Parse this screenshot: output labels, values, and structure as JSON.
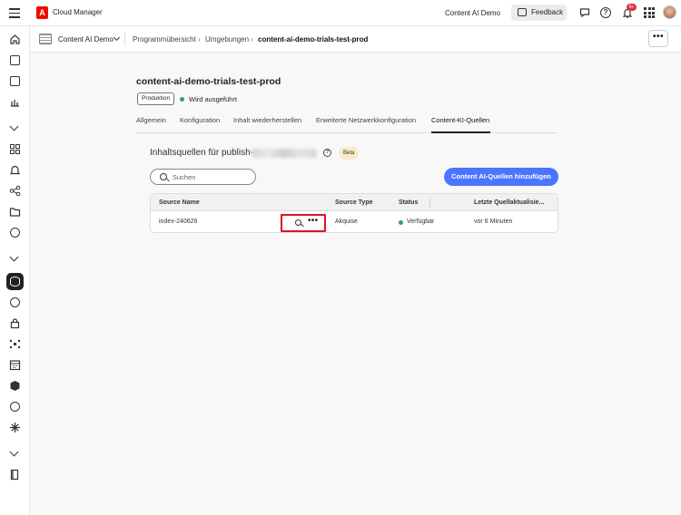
{
  "app": {
    "title": "Cloud Manager",
    "logo_letter": "A",
    "org_name": "Content AI Demo",
    "feedback_label": "Feedback",
    "notification_count": "9+"
  },
  "breadcrumb": {
    "program_name": "Content AI Demo",
    "items": [
      "Programmübersicht",
      "Umgebungen",
      "content-ai-demo-trials-test-prod"
    ],
    "more_label": "•••"
  },
  "environment": {
    "title": "content-ai-demo-trials-test-prod",
    "tag": "Produktion",
    "status": "Wird ausgeführt",
    "status_color": "#2d9d78"
  },
  "tabs": [
    {
      "label": "Allgemein"
    },
    {
      "label": "Konfiguration"
    },
    {
      "label": "Inhalt wiederherstellen"
    },
    {
      "label": "Erweiterte Netzwerkkonfiguration"
    },
    {
      "label": "Content-KI-Quellen",
      "selected": true
    }
  ],
  "sources": {
    "title": "Inhaltsquellen für publish-",
    "info_icon": "?",
    "beta_label": "Beta",
    "search_placeholder": "Suchen",
    "add_button": "Content AI-Quellen hinzufügen",
    "accent_color": "#4b75ff",
    "columns": [
      "Source Name",
      "Source Type",
      "Status",
      "Letzte Quellaktualisie..."
    ],
    "rows": [
      {
        "name": "index-240626",
        "type": "Akquise",
        "status": "Verfügbar",
        "updated": "vor 6 Minuten",
        "more_label": "•••"
      }
    ]
  },
  "icons": {
    "topbar": [
      "menu-icon",
      "adobe-logo",
      "feedback-icon",
      "chat-icon",
      "help-icon",
      "bell-icon",
      "apps-grid-icon"
    ],
    "sidebar": [
      "home-icon",
      "programs-icon",
      "environments-icon",
      "pipelines-icon",
      "overview-icon",
      "alerts-icon",
      "integrations-icon",
      "files-icon",
      "monitoring-icon",
      "database-icon",
      "settings-icon",
      "lock-icon",
      "network-icon",
      "calendar-icon",
      "package-icon",
      "history-icon",
      "sparkle-icon",
      "docs-icon"
    ]
  }
}
